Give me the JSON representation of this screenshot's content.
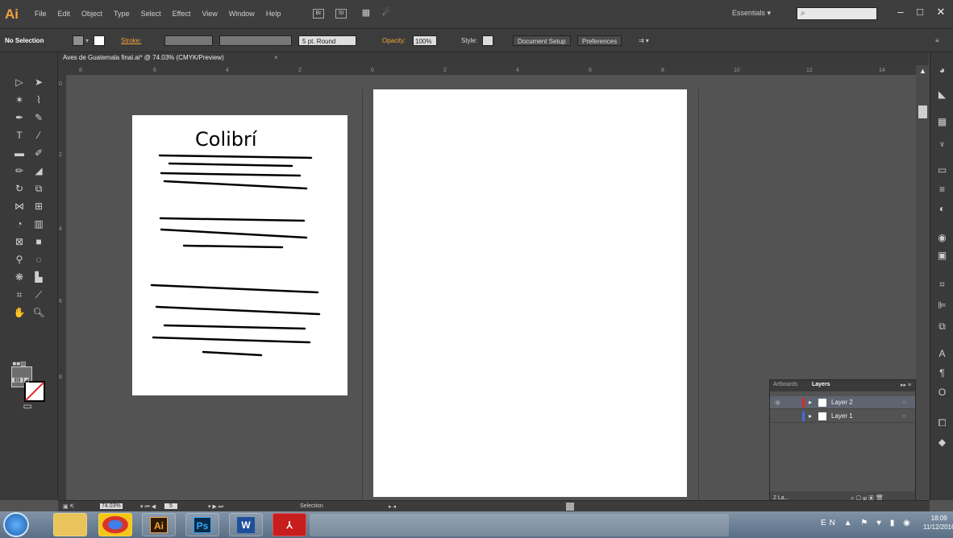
{
  "app": {
    "logo": "Ai"
  },
  "menu": [
    "File",
    "Edit",
    "Object",
    "Type",
    "Select",
    "Effect",
    "View",
    "Window",
    "Help"
  ],
  "menu_icons": [
    "Br",
    "St"
  ],
  "workspace": "Essentials",
  "window_buttons": [
    "–",
    "□",
    "✕"
  ],
  "control": {
    "selection": "No Selection",
    "stroke_label": "Stroke:",
    "brush": "5 pt. Round",
    "opacity_label": "Opacity:",
    "opacity_value": "100%",
    "style_label": "Style:",
    "document_setup": "Document Setup",
    "preferences": "Preferences"
  },
  "document": {
    "tab_title": "Aves de Guatemala final.ai* @ 74.03% (CMYK/Preview)",
    "tab_close": "×"
  },
  "ruler_h_labels": [
    "8",
    "6",
    "4",
    "2",
    "0",
    "2",
    "4",
    "6",
    "8",
    "10",
    "12",
    "14"
  ],
  "ruler_v_labels": [
    "0",
    "2",
    "4",
    "6",
    "8"
  ],
  "artboard1": {
    "title": "Colibrí"
  },
  "layers": {
    "tabs": [
      "Artboards",
      "Layers"
    ],
    "rows": [
      {
        "name": "Layer 2",
        "color": "#e0262b",
        "selected": true
      },
      {
        "name": "Layer 1",
        "color": "#3b6ee8",
        "selected": false
      }
    ],
    "count": "2 La..."
  },
  "status": {
    "zoom": "74.03%",
    "page": "5",
    "tool": "Selection"
  },
  "taskbar": {
    "apps": [
      {
        "label": "Ai",
        "color": "#2d1a04"
      },
      {
        "label": "Ps",
        "color": "#0b2a45"
      },
      {
        "label": "W",
        "color": "#1e4f9a"
      },
      {
        "label": "",
        "color": "#c81d1d"
      }
    ],
    "lang": "EN",
    "time": "18:09",
    "date": "11/12/2016"
  },
  "colors": {
    "artboard": "#ffffff",
    "canvas": "#535353",
    "accent": "#f7a040"
  }
}
